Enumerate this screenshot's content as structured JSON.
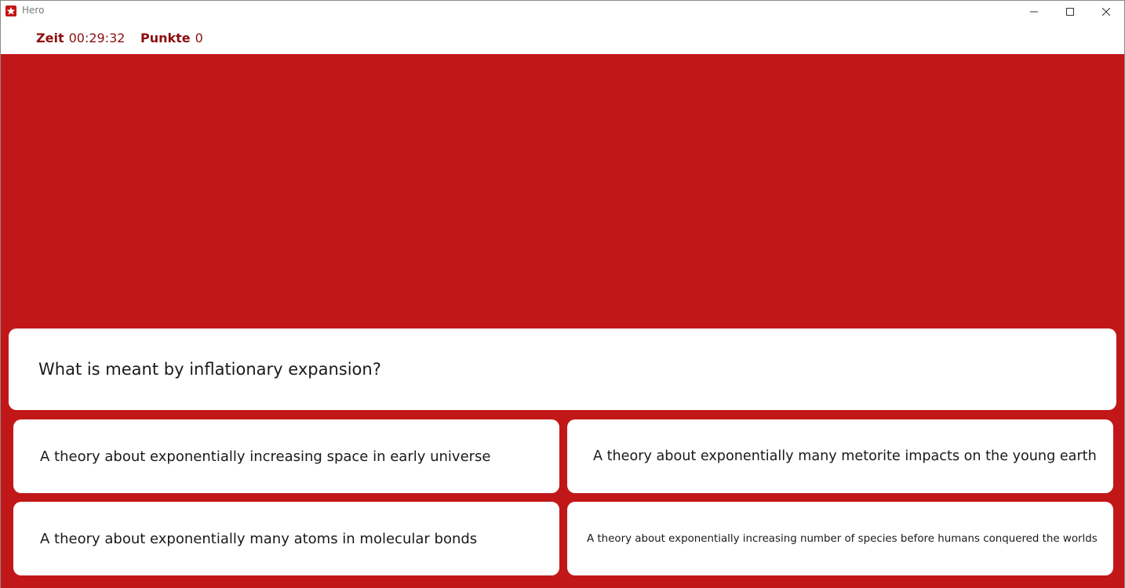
{
  "window": {
    "title": "Hero",
    "accent_color": "#c21718"
  },
  "stats": {
    "time_label": "Zeit",
    "time_value": "00:29:32",
    "points_label": "Punkte",
    "points_value": "0"
  },
  "quiz": {
    "question": "What is meant by inflationary expansion?",
    "answers": [
      "A theory about exponentially increasing space in early universe",
      "A theory about exponentially many metorite impacts on the young earth",
      "A theory about exponentially many atoms in molecular bonds",
      "A theory about exponentially increasing number of species before humans conquered the worlds"
    ]
  },
  "icons": {
    "app": "star-icon",
    "minimize": "minimize-icon",
    "maximize": "maximize-icon",
    "close": "close-icon"
  }
}
